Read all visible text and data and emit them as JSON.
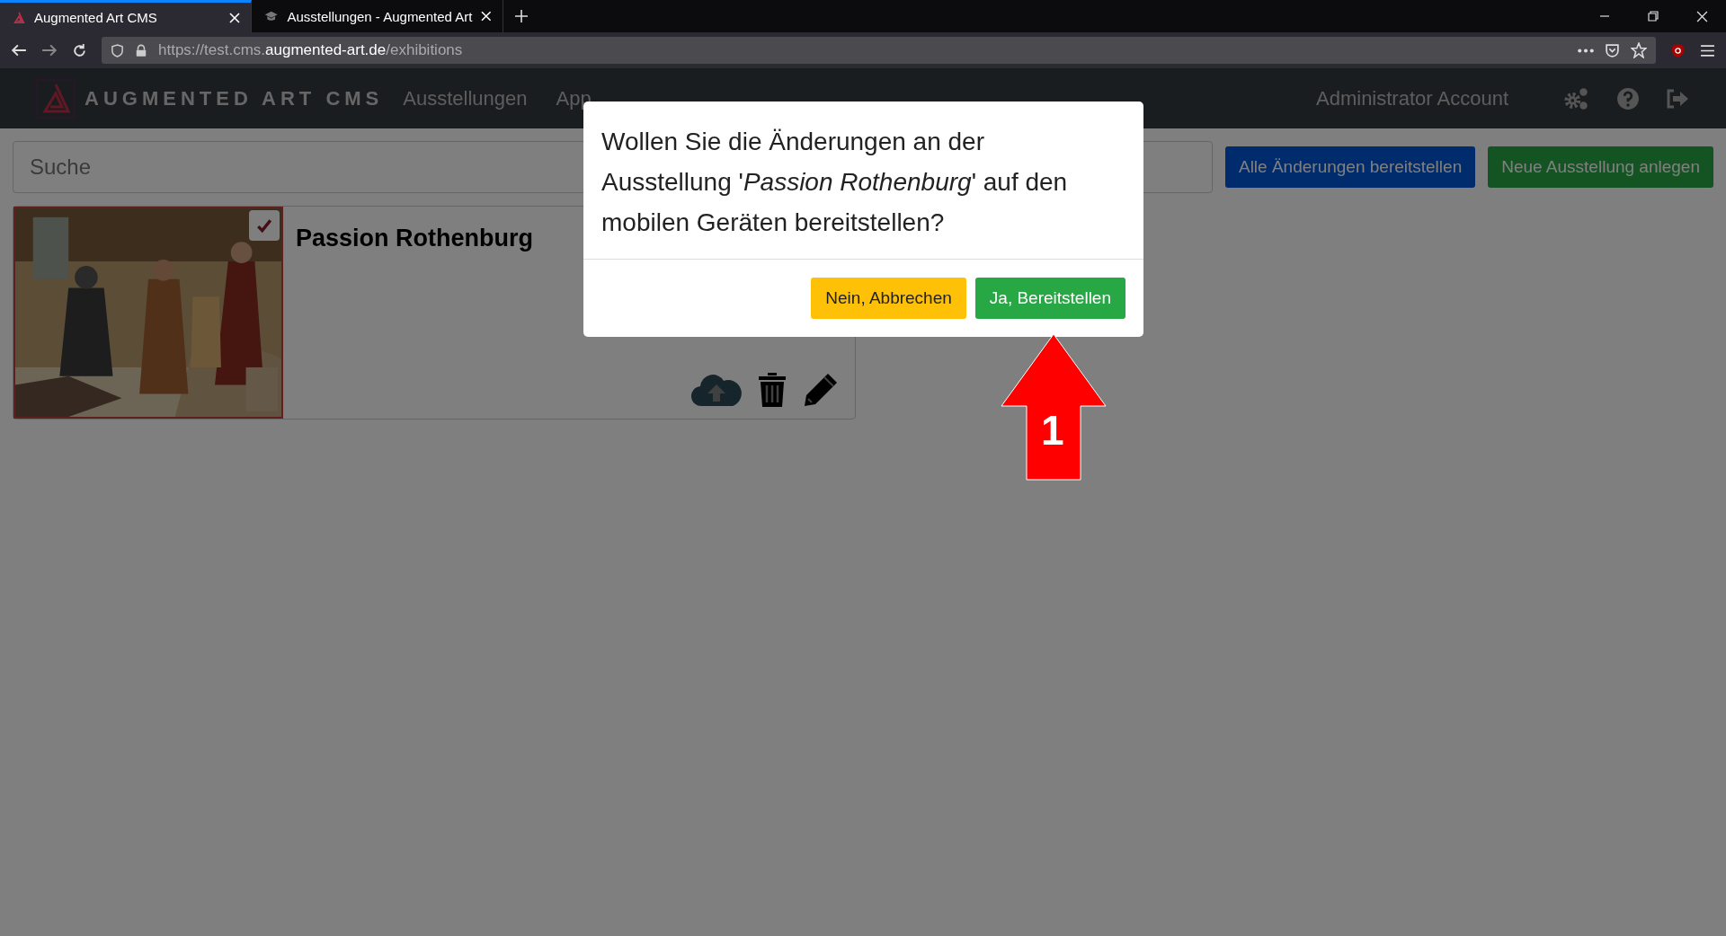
{
  "browser": {
    "tabs": [
      {
        "title": "Augmented Art CMS",
        "selected": true
      },
      {
        "title": "Ausstellungen - Augmented Art",
        "selected": false
      }
    ],
    "url_prefix": "https://test.cms.",
    "url_domain": "augmented-art.de",
    "url_path": "/exhibitions"
  },
  "navbar": {
    "brand": "AUGMENTED ART CMS",
    "items": [
      "Ausstellungen",
      "App"
    ],
    "account": "Administrator Account"
  },
  "search": {
    "placeholder": "Suche"
  },
  "actions": [
    "Alle Änderungen bereitstellen",
    "Neue Ausstellung anlegen"
  ],
  "exhibitions": [
    {
      "title": "Passion Rothenburg",
      "checked": true
    }
  ],
  "dialog": {
    "message": "Wollen Sie die Änderungen an der Ausstellung '*Passion Rothenburg*' auf den mobilen Geräten bereitstellen?",
    "buttons": [
      {
        "label": "Nein, Abbrechen",
        "kind": "cancel"
      },
      {
        "label": "Ja, Bereitstellen",
        "kind": "confirm"
      }
    ]
  },
  "annotation": {
    "label": "1"
  }
}
